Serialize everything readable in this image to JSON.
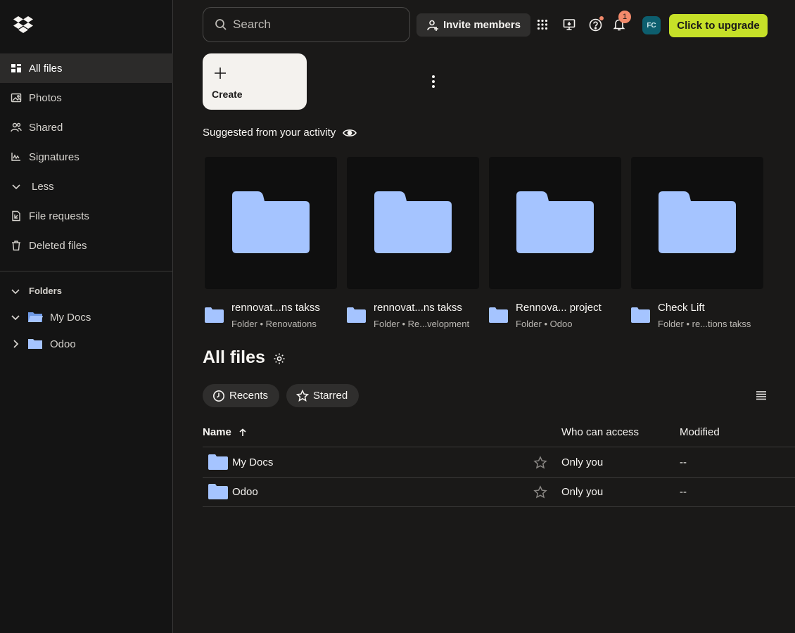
{
  "sidebar": {
    "nav": [
      {
        "label": "All files",
        "icon": "all-files-icon"
      },
      {
        "label": "Photos",
        "icon": "photos-icon"
      },
      {
        "label": "Shared",
        "icon": "shared-icon"
      },
      {
        "label": "Signatures",
        "icon": "signatures-icon"
      },
      {
        "label": "Less",
        "icon": "chevron-down-icon"
      },
      {
        "label": "File requests",
        "icon": "file-requests-icon"
      },
      {
        "label": "Deleted files",
        "icon": "trash-icon"
      }
    ],
    "folders_heading": "Folders",
    "tree": [
      {
        "label": "My Docs",
        "expanded": true
      },
      {
        "label": "Odoo",
        "expanded": false
      }
    ]
  },
  "topbar": {
    "search_placeholder": "Search",
    "invite_label": "Invite members",
    "notification_count": "1",
    "avatar_initials": "FC",
    "upgrade_label": "Click to upgrade"
  },
  "create": {
    "label": "Create"
  },
  "suggested": {
    "title": "Suggested from your activity",
    "cards": [
      {
        "name": "rennovat...ns takss",
        "sub": "Folder • Renovations"
      },
      {
        "name": "rennovat...ns takss",
        "sub": "Folder • Re...velopment"
      },
      {
        "name": "Rennova... project",
        "sub": "Folder • Odoo"
      },
      {
        "name": "Check Lift",
        "sub": "Folder • re...tions takss"
      }
    ]
  },
  "all_files": {
    "title": "All files",
    "chips": [
      "Recents",
      "Starred"
    ],
    "columns": {
      "name": "Name",
      "access": "Who can access",
      "modified": "Modified"
    },
    "rows": [
      {
        "name": "My Docs",
        "access": "Only you",
        "modified": "--"
      },
      {
        "name": "Odoo",
        "access": "Only you",
        "modified": "--"
      }
    ]
  },
  "colors": {
    "background": "#1a1918",
    "sidebar": "#141414",
    "folder": "#a5c4ff",
    "upgrade": "#c6e028",
    "badge": "#f28a6b"
  }
}
